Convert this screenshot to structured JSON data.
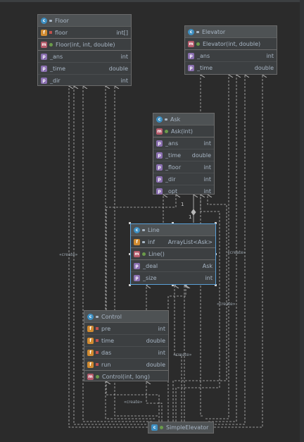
{
  "classes": {
    "floor": {
      "name": "Floor",
      "fields": [
        {
          "name": "floor",
          "type": "int[]"
        }
      ],
      "constructors": [
        {
          "name": "Floor(int, int, double)"
        }
      ],
      "properties": [
        {
          "name": "_ans",
          "type": "int"
        },
        {
          "name": "_time",
          "type": "double"
        },
        {
          "name": "_dir",
          "type": "int"
        }
      ]
    },
    "elevator": {
      "name": "Elevator",
      "constructors": [
        {
          "name": "Elevator(int, double)"
        }
      ],
      "properties": [
        {
          "name": "_ans",
          "type": "int"
        },
        {
          "name": "_time",
          "type": "double"
        }
      ]
    },
    "ask": {
      "name": "Ask",
      "constructors": [
        {
          "name": "Ask(int)"
        }
      ],
      "properties": [
        {
          "name": "_ans",
          "type": "int"
        },
        {
          "name": "_time",
          "type": "double"
        },
        {
          "name": "_floor",
          "type": "int"
        },
        {
          "name": "_dir",
          "type": "int"
        },
        {
          "name": "_opt",
          "type": "int"
        }
      ]
    },
    "line": {
      "name": "Line",
      "fields": [
        {
          "name": "inf",
          "type": "ArrayList<Ask>"
        }
      ],
      "constructors": [
        {
          "name": "Line()"
        }
      ],
      "properties": [
        {
          "name": "_deal",
          "type": "Ask"
        },
        {
          "name": "_size",
          "type": "int"
        }
      ]
    },
    "control": {
      "name": "Control",
      "fields": [
        {
          "name": "pre",
          "type": "int"
        },
        {
          "name": "time",
          "type": "double"
        },
        {
          "name": "das",
          "type": "int"
        },
        {
          "name": "run",
          "type": "double"
        }
      ],
      "constructors": [
        {
          "name": "Control(int, long)"
        }
      ]
    },
    "simple_elevator": {
      "name": "SimpleElevator"
    }
  },
  "stereotypes": {
    "create": "«create»"
  },
  "multiplicity": {
    "one_a": "1",
    "one_b": "1"
  },
  "colors": {
    "background": "#2b2b2b",
    "box": "#3c3f41",
    "header": "#4e5254",
    "text": "#a9b7c6",
    "line": "#b8b8b8",
    "selection": "#5aa0d8"
  }
}
